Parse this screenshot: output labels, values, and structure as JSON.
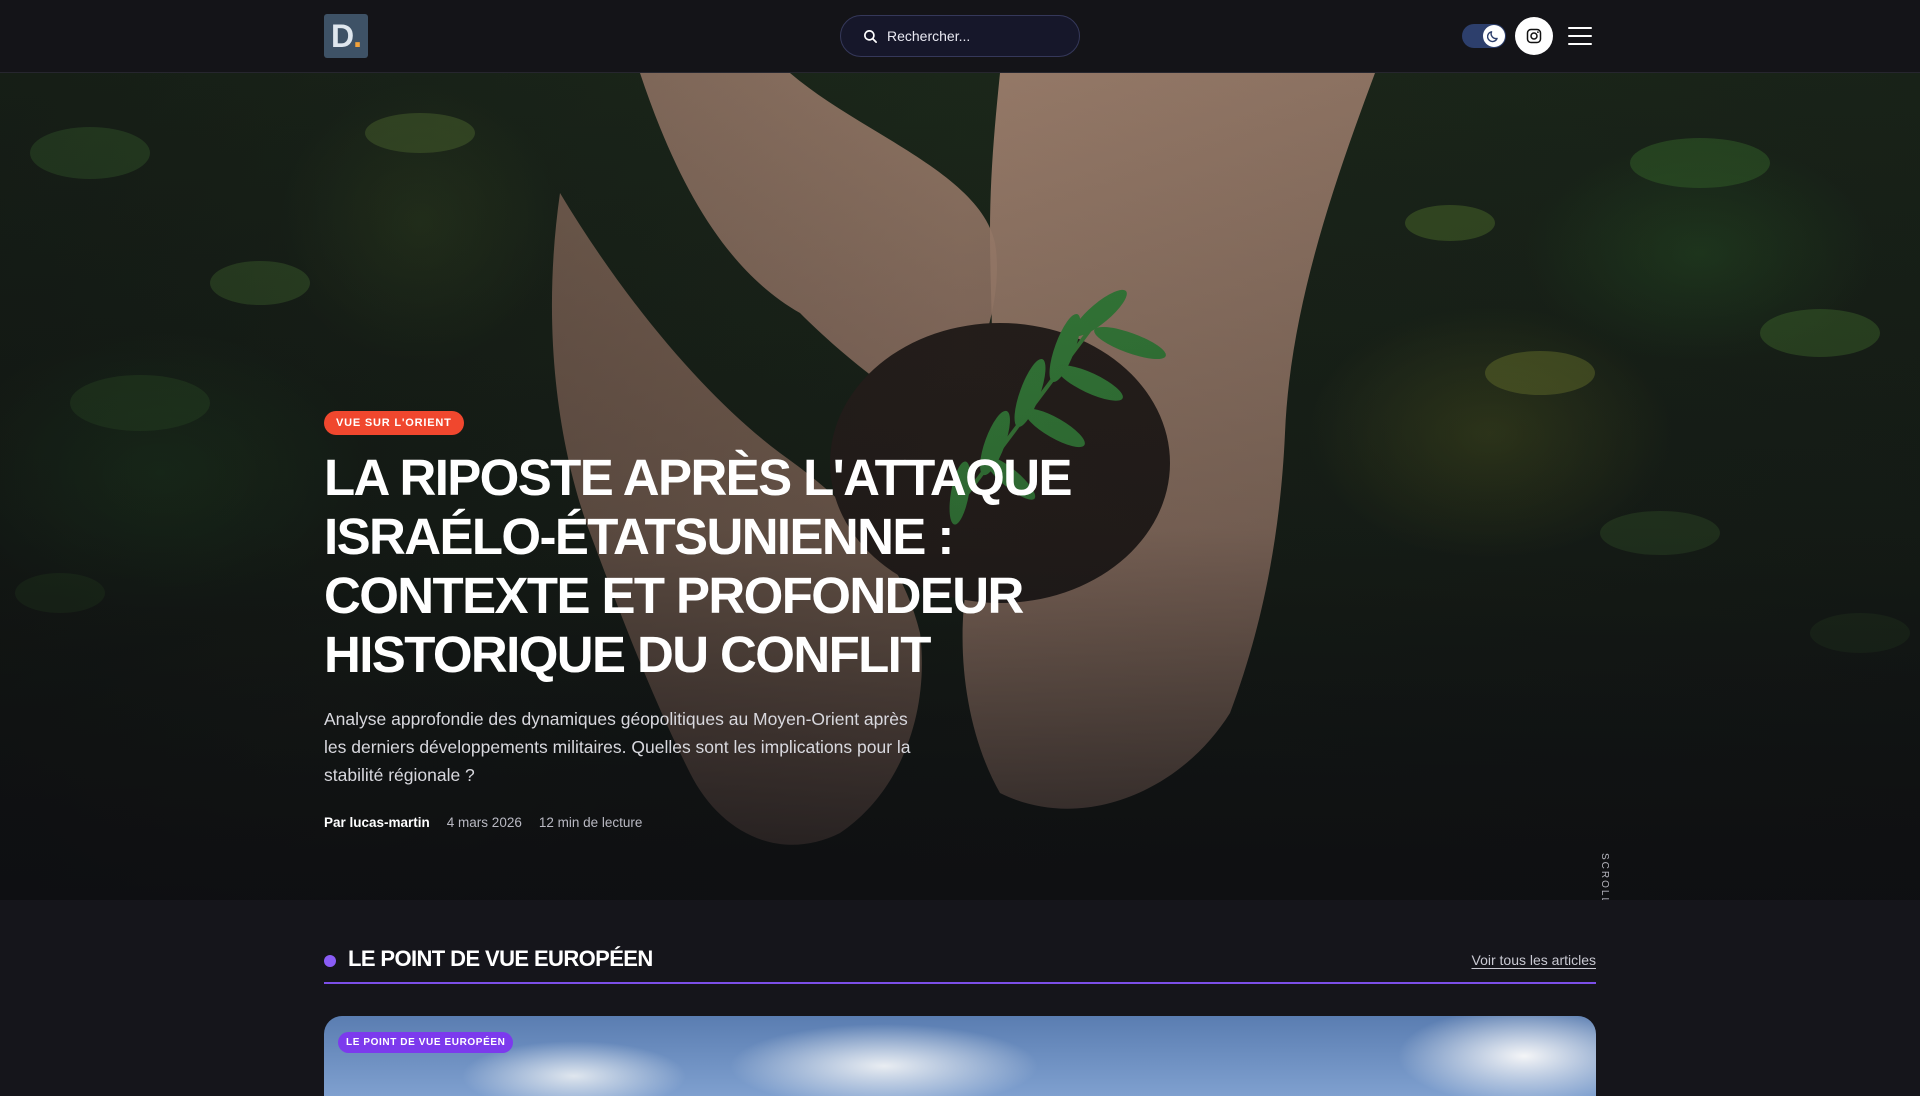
{
  "header": {
    "logo_letter": "D",
    "logo_dot": ".",
    "search_placeholder": "Rechercher...",
    "icons": [
      "search-icon",
      "moon-icon",
      "instagram-icon",
      "hamburger-menu-icon"
    ],
    "theme": "dark"
  },
  "hero": {
    "category": "VUE SUR L'ORIENT",
    "title": "LA RIPOSTE APRÈS L'ATTAQUE ISRAÉLO-ÉTATSUNIENNE : CONTEXTE ET PROFONDEUR HISTORIQUE DU CONFLIT",
    "description": "Analyse approfondie des dynamiques géopolitiques au Moyen-Orient après les derniers développements militaires. Quelles sont les implications pour la stabilité régionale ?",
    "author": "Par lucas-martin",
    "date": "4 mars 2026",
    "reading_time": "12 min de lecture",
    "scroll_label": "SCROLL"
  },
  "section": {
    "title": "LE POINT DE VUE EUROPÉEN",
    "link": "Voir tous les articles",
    "card_badge": "LE POINT DE VUE EUROPÉEN"
  },
  "colors": {
    "background": "#15151b",
    "hero_badge": "#f0472e",
    "accent": "#7c4fe8",
    "card_badge": "#7c3aed"
  }
}
